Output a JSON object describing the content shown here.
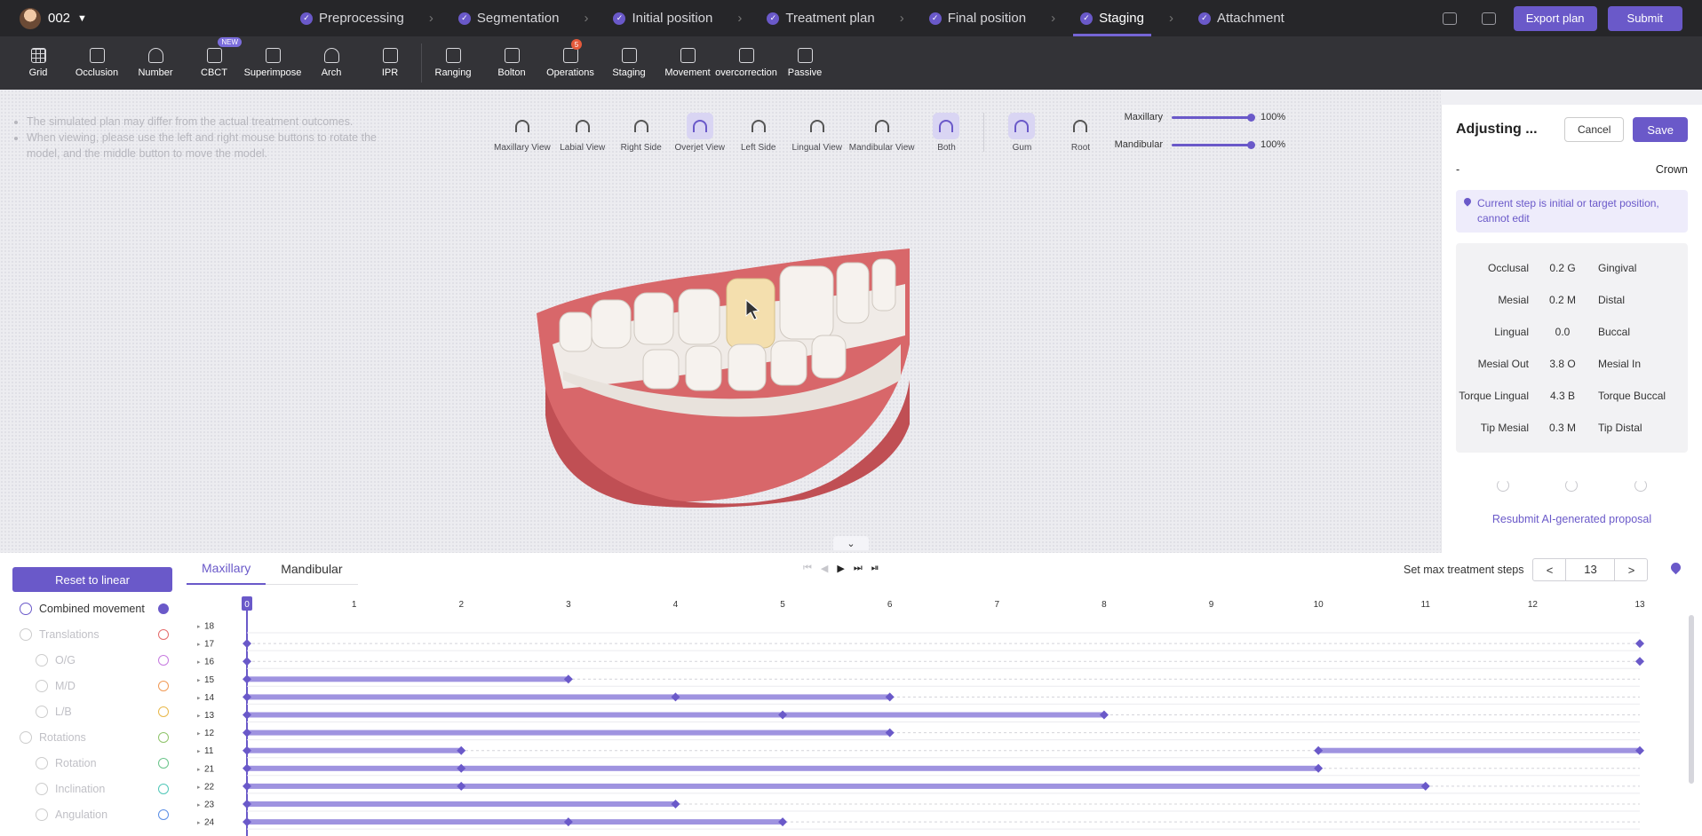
{
  "patient": {
    "id": "002"
  },
  "workflow": [
    {
      "label": "Preprocessing",
      "active": false
    },
    {
      "label": "Segmentation",
      "active": false
    },
    {
      "label": "Initial position",
      "active": false
    },
    {
      "label": "Treatment plan",
      "active": false
    },
    {
      "label": "Final position",
      "active": false
    },
    {
      "label": "Staging",
      "active": true
    },
    {
      "label": "Attachment",
      "active": false
    }
  ],
  "header": {
    "export_label": "Export plan",
    "submit_label": "Submit"
  },
  "toolbar": {
    "groups": [
      [
        "Grid",
        "Occlusion",
        "Number",
        "CBCT",
        "Superimpose",
        "Arch",
        "IPR"
      ],
      [
        "Ranging",
        "Bolton",
        "Operations",
        "Staging",
        "Movement",
        "overcorrection",
        "Passive"
      ]
    ],
    "new_badge": "NEW",
    "operations_count": "5"
  },
  "notes": [
    "The simulated plan may differ from the actual treatment outcomes.",
    "When viewing, please use the left and right mouse buttons to rotate the model, and the middle button to move the model."
  ],
  "views": [
    "Maxillary View",
    "Labial View",
    "Right Side",
    "Overjet View",
    "Left Side",
    "Lingual View",
    "Mandibular View",
    "Both"
  ],
  "view_selected": [
    "Overjet View",
    "Both"
  ],
  "display": [
    "Gum",
    "Root"
  ],
  "display_selected": [
    "Gum"
  ],
  "opacity": [
    {
      "label": "Maxillary",
      "value": "100%"
    },
    {
      "label": "Mandibular",
      "value": "100%"
    }
  ],
  "panel": {
    "title": "Adjusting ...",
    "cancel": "Cancel",
    "save": "Save",
    "tooth": "-",
    "mode": "Crown",
    "alert": "Current step is initial or target position, cannot edit",
    "movements": [
      {
        "left": "Occlusal",
        "value": "0.2 G",
        "right": "Gingival"
      },
      {
        "left": "Mesial",
        "value": "0.2 M",
        "right": "Distal"
      },
      {
        "left": "Lingual",
        "value": "0.0",
        "right": "Buccal"
      },
      {
        "left": "Mesial Out",
        "value": "3.8 O",
        "right": "Mesial In"
      },
      {
        "left": "Torque Lingual",
        "value": "4.3 B",
        "right": "Torque Buccal"
      },
      {
        "left": "Tip Mesial",
        "value": "0.3 M",
        "right": "Tip Distal"
      }
    ],
    "resubmit": "Resubmit AI-generated proposal"
  },
  "bottom": {
    "reset": "Reset to linear",
    "movement_types": [
      {
        "label": "Combined movement",
        "level": 0,
        "active": true,
        "color": "#6a59c9"
      },
      {
        "label": "Translations",
        "level": 0,
        "active": false,
        "color": "#e56b6b"
      },
      {
        "label": "O/G",
        "level": 1,
        "active": false,
        "color": "#c77be0"
      },
      {
        "label": "M/D",
        "level": 1,
        "active": false,
        "color": "#f19a56"
      },
      {
        "label": "L/B",
        "level": 1,
        "active": false,
        "color": "#e8b84a"
      },
      {
        "label": "Rotations",
        "level": 0,
        "active": false,
        "color": "#8fc46a"
      },
      {
        "label": "Rotation",
        "level": 1,
        "active": false,
        "color": "#6ac48a"
      },
      {
        "label": "Inclination",
        "level": 1,
        "active": false,
        "color": "#4fc7b8"
      },
      {
        "label": "Angulation",
        "level": 1,
        "active": false,
        "color": "#5a8ee6"
      }
    ],
    "jaw_tabs": [
      "Maxillary",
      "Mandibular"
    ],
    "jaw_active": "Maxillary",
    "max_steps_label": "Set max treatment steps",
    "prev": "<",
    "next": ">",
    "max_steps": "13",
    "current_step": 0,
    "step_count": 13,
    "teeth": [
      {
        "tooth": "18",
        "diamonds": [],
        "segments": []
      },
      {
        "tooth": "17",
        "diamonds": [
          0,
          13
        ],
        "segments": []
      },
      {
        "tooth": "16",
        "diamonds": [
          0,
          13
        ],
        "segments": []
      },
      {
        "tooth": "15",
        "diamonds": [
          0,
          3
        ],
        "segments": [
          [
            0,
            3
          ]
        ]
      },
      {
        "tooth": "14",
        "diamonds": [
          0,
          4,
          6
        ],
        "segments": [
          [
            0,
            6
          ]
        ]
      },
      {
        "tooth": "13",
        "diamonds": [
          0,
          5,
          8
        ],
        "segments": [
          [
            0,
            8
          ]
        ]
      },
      {
        "tooth": "12",
        "diamonds": [
          0,
          6
        ],
        "segments": [
          [
            0,
            6
          ]
        ]
      },
      {
        "tooth": "11",
        "diamonds": [
          0,
          2,
          10,
          13
        ],
        "segments": [
          [
            0,
            2
          ],
          [
            10,
            13
          ]
        ]
      },
      {
        "tooth": "21",
        "diamonds": [
          0,
          2,
          10
        ],
        "segments": [
          [
            0,
            10
          ]
        ]
      },
      {
        "tooth": "22",
        "diamonds": [
          0,
          2,
          11
        ],
        "segments": [
          [
            0,
            11
          ]
        ]
      },
      {
        "tooth": "23",
        "diamonds": [
          0,
          4
        ],
        "segments": [
          [
            0,
            4
          ]
        ]
      },
      {
        "tooth": "24",
        "diamonds": [
          0,
          3,
          5
        ],
        "segments": [
          [
            0,
            5
          ]
        ]
      }
    ]
  }
}
